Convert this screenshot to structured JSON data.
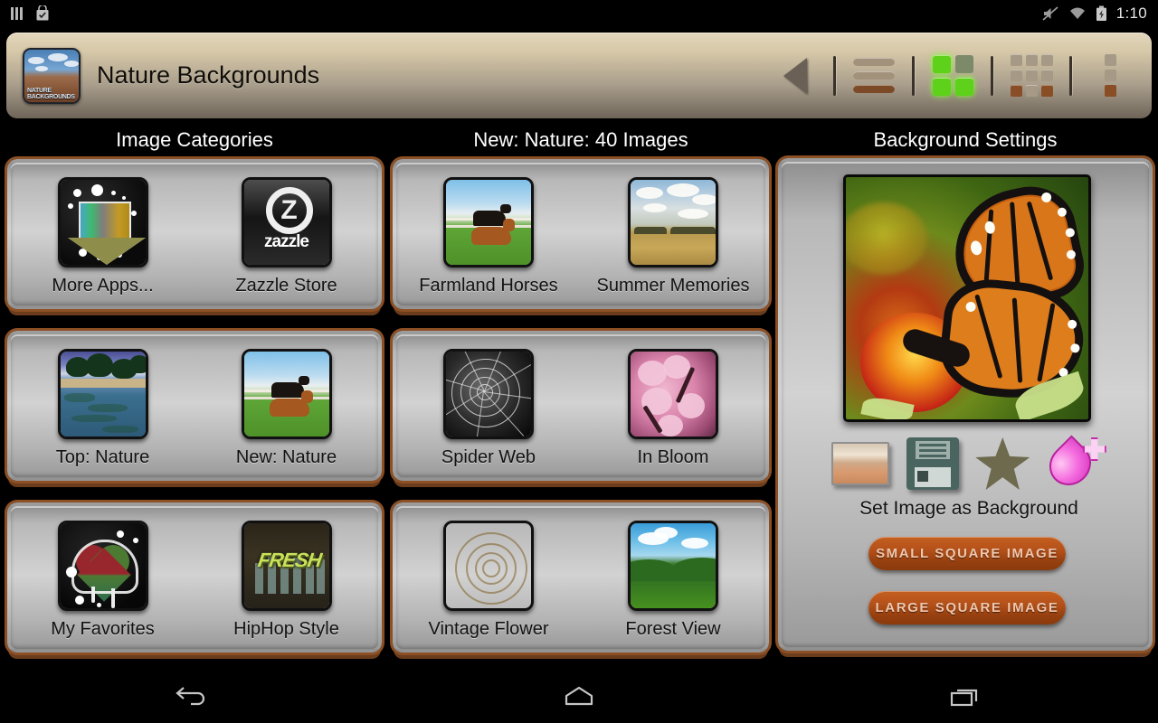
{
  "statusbar": {
    "time": "1:10",
    "left_icons": [
      "signal-bars-icon",
      "shopping-bag-check-icon"
    ],
    "right_icons": [
      "mute-icon",
      "wifi-icon",
      "battery-charging-icon"
    ]
  },
  "titlebar": {
    "app_icon_name": "nature-backgrounds-app-icon",
    "app_icon_caption": "NATURE BACKGROUNDS",
    "title": "Nature Backgrounds",
    "actions": [
      {
        "name": "back-button",
        "icon": "back-triangle-icon",
        "active": false
      },
      {
        "name": "list-view-button",
        "icon": "list-lines-icon",
        "active": false
      },
      {
        "name": "grid-2x2-view-button",
        "icon": "grid-2x2-icon",
        "active": true
      },
      {
        "name": "grid-3x3-view-button",
        "icon": "grid-3x3-icon",
        "active": false
      },
      {
        "name": "overflow-menu-button",
        "icon": "dots-vertical-icon",
        "active": false
      }
    ]
  },
  "columns": {
    "categories": {
      "header": "Image Categories",
      "rows": [
        [
          {
            "label": "More Apps...",
            "art": "t-moreapps"
          },
          {
            "label": "Zazzle Store",
            "art": "t-zazzle"
          }
        ],
        [
          {
            "label": "Top: Nature",
            "art": "t-lagoon"
          },
          {
            "label": "New: Nature",
            "art": "t-horses"
          }
        ],
        [
          {
            "label": "My Favorites",
            "art": "t-fav"
          },
          {
            "label": "HipHop Style",
            "art": "t-hip"
          }
        ]
      ]
    },
    "images": {
      "header": "New: Nature: 40 Images",
      "rows": [
        [
          {
            "label": "Farmland Horses",
            "art": "t-horses"
          },
          {
            "label": "Summer Memories",
            "art": "t-summer"
          }
        ],
        [
          {
            "label": "Spider Web",
            "art": "t-web"
          },
          {
            "label": "In Bloom",
            "art": "t-bloom"
          }
        ],
        [
          {
            "label": "Vintage Flower",
            "art": "t-vint"
          },
          {
            "label": "Forest View",
            "art": "t-forest"
          }
        ]
      ]
    },
    "settings": {
      "header": "Background Settings",
      "preview_name": "monarch-butterfly-preview",
      "icons": [
        {
          "name": "set-wallpaper-icon",
          "label": "wallpaper-icon"
        },
        {
          "name": "save-image-icon",
          "label": "floppy-disk-icon"
        },
        {
          "name": "rate-star-icon",
          "label": "star-icon"
        },
        {
          "name": "add-favorite-icon",
          "label": "heart-plus-icon"
        }
      ],
      "set_label": "Set Image as Background",
      "buttons": [
        {
          "name": "small-square-image-button",
          "label": "SMALL SQUARE IMAGE"
        },
        {
          "name": "large-square-image-button",
          "label": "LARGE SQUARE IMAGE"
        }
      ]
    }
  },
  "navbar": {
    "items": [
      {
        "name": "nav-back-button",
        "icon": "back-arrow-icon"
      },
      {
        "name": "nav-home-button",
        "icon": "home-icon"
      },
      {
        "name": "nav-recents-button",
        "icon": "recents-icon"
      }
    ]
  },
  "colors": {
    "accent_green": "#5ed11a",
    "panel_border": "#8d4f24",
    "button_orange": "#b4511a",
    "titlebar_top": "#e3d7bc",
    "titlebar_bottom": "#6e6458"
  }
}
